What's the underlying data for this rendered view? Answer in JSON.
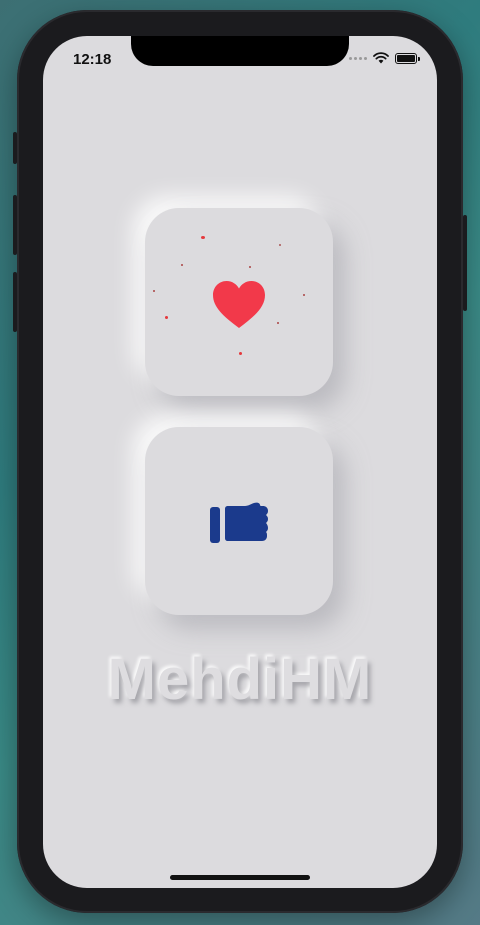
{
  "status_bar": {
    "time": "12:18"
  },
  "cards": {
    "like": {
      "icon": "heart-icon",
      "color": "#f2394a",
      "particle_color": "#e5383c"
    },
    "thumb": {
      "icon": "thumbs-up-icon",
      "color": "#1b3a8c"
    }
  },
  "watermark": {
    "text": "MehdiHM"
  }
}
